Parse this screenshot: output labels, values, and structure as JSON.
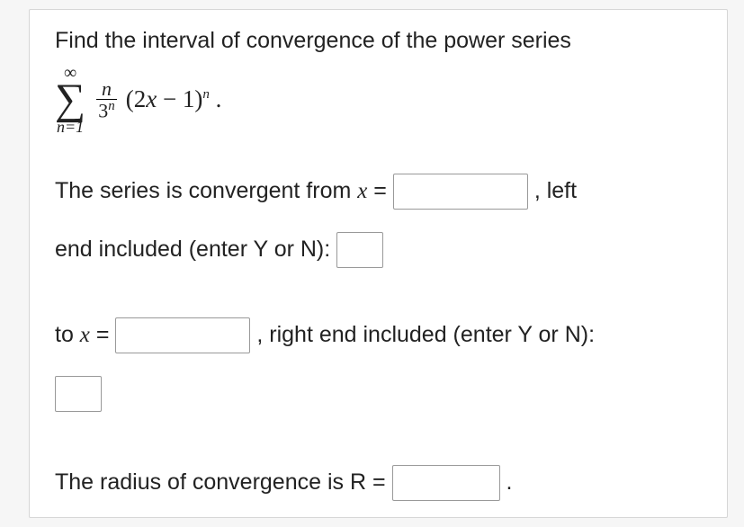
{
  "prompt": "Find the interval of convergence of the power series",
  "formula": {
    "sigma_top": "∞",
    "sigma_symbol": "∑",
    "sigma_bottom": "n=1",
    "frac_top": "n",
    "frac_bottom_base": "3",
    "frac_bottom_exp": "n",
    "expr_open": "(2",
    "expr_var": "x",
    "expr_mid": " − 1)",
    "expr_exp": "n",
    "expr_end": " ."
  },
  "line1_a": "The series is convergent from ",
  "line1_var": "x",
  "line1_eq": " = ",
  "line1_b": ", left",
  "line2": "end included (enter Y or N): ",
  "line3_a": "to ",
  "line3_var": "x",
  "line3_eq": " = ",
  "line3_b": ", right end included (enter Y or N):",
  "line4_a": "The radius of convergence is R = ",
  "line4_b": "."
}
